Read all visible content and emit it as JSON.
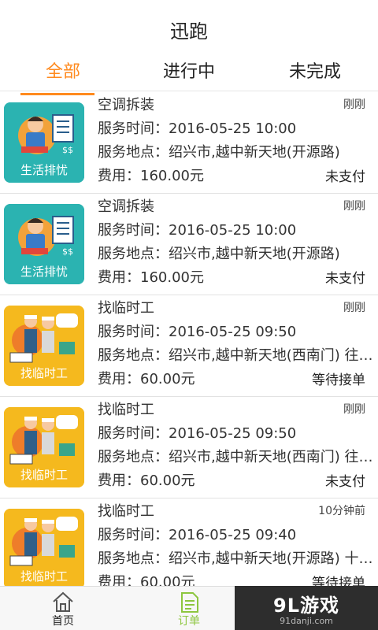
{
  "app": {
    "title": "迅跑"
  },
  "tabs": [
    {
      "label": "全部",
      "active": true
    },
    {
      "label": "进行中",
      "active": false
    },
    {
      "label": "未完成",
      "active": false
    }
  ],
  "orders": [
    {
      "title": "空调拆装",
      "time_ago": "刚刚",
      "service_time": "服务时间：2016-05-25 10:00",
      "service_location": "服务地点：绍兴市,越中新天地(开源路)",
      "fee": "费用：160.00元",
      "status": "未支付",
      "thumb_caption": "生活排忧",
      "thumb_color": "#2bb3b1"
    },
    {
      "title": "空调拆装",
      "time_ago": "刚刚",
      "service_time": "服务时间：2016-05-25 10:00",
      "service_location": "服务地点：绍兴市,越中新天地(开源路)",
      "fee": "费用：160.00元",
      "status": "未支付",
      "thumb_caption": "生活排忧",
      "thumb_color": "#2bb3b1"
    },
    {
      "title": "找临时工",
      "time_ago": "刚刚",
      "service_time": "服务时间：2016-05-25 09:50",
      "service_location": "服务地点：绍兴市,越中新天地(西南门) 往里...",
      "fee": "费用：60.00元",
      "status": "等待接单",
      "thumb_caption": "找临时工",
      "thumb_color": "#f5b91e"
    },
    {
      "title": "找临时工",
      "time_ago": "刚刚",
      "service_time": "服务时间：2016-05-25 09:50",
      "service_location": "服务地点：绍兴市,越中新天地(西南门) 往里...",
      "fee": "费用：60.00元",
      "status": "未支付",
      "thumb_caption": "找临时工",
      "thumb_color": "#f5b91e"
    },
    {
      "title": "找临时工",
      "time_ago": "10分钟前",
      "service_time": "服务时间：2016-05-25 09:40",
      "service_location": "服务地点：绍兴市,越中新天地(开源路) 十五...",
      "fee": "费用：60.00元",
      "status": "等待接单",
      "thumb_caption": "找临时工",
      "thumb_color": "#f5b91e"
    }
  ],
  "bottom_nav": [
    {
      "label": "首页",
      "icon": "home-icon"
    },
    {
      "label": "订单",
      "icon": "order-icon"
    }
  ],
  "watermark": {
    "main": "9L游戏",
    "sub": "91danji.com"
  },
  "colors": {
    "accent": "#ff8a1e",
    "active_nav": "#8dc63f",
    "teal": "#2bb3b1",
    "yellow": "#f5b91e"
  }
}
